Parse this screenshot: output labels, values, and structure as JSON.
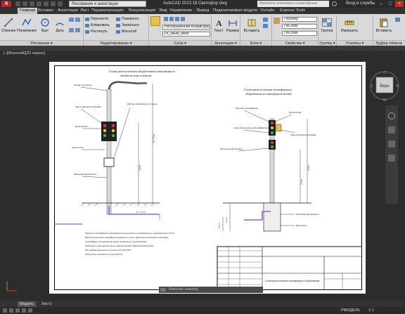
{
  "titlebar": {
    "logo": "A",
    "workspace": "Рисование и аннотации",
    "app_title": "AutoCAD 2013    18 Светофор.dwg",
    "search_placeholder": "Введите ключевое слово/фразу",
    "signin": "Вход в службы",
    "minimize": "–",
    "maximize": "□",
    "close": "×"
  },
  "tabs": [
    "Главная",
    "Вставка",
    "Аннотации",
    "Лист",
    "Параметризация",
    "Визуализация",
    "Вид",
    "Управление",
    "Вывод",
    "Подключаемые модули",
    "Онлайн",
    "Express Tools"
  ],
  "ribbon": {
    "draw": {
      "line": "Отрезок",
      "polyline": "Полилиния",
      "circle": "Круг",
      "arc": "Дуга",
      "panel": "Рисование ▾"
    },
    "modify": {
      "move": "Перенести",
      "rotate": "Повернуть",
      "copy": "Копировать",
      "mirror": "Зеркально",
      "stretch": "Растянуть",
      "scale": "Масштаб",
      "panel": "Редактирование ▾"
    },
    "layers": {
      "state": "Несохраненная конфигурация сло",
      "current": "LK_NEW_неок",
      "panel": "Слои ▾"
    },
    "annotation": {
      "text": "Текст",
      "dimension": "Размер",
      "panel": "Аннотации ▾"
    },
    "block": {
      "insert": "Вставить",
      "panel": "Блок ▾"
    },
    "properties": {
      "color": "ПоБлоку",
      "linetype": "ПоСлою",
      "lineweight": "ПоСлою",
      "panel": "Свойства ▾"
    },
    "groups": {
      "group": "Группа",
      "panel": "Группы ▾"
    },
    "utilities": {
      "measure": "Измерить",
      "panel": "Утилиты ▾"
    },
    "clipboard": {
      "paste": "Вставить",
      "panel": "Буфер обмена"
    }
  },
  "viewport": {
    "label": "[–][Верхний][2D каркас]"
  },
  "viewcube": {
    "top": "Верх",
    "n": "С",
    "s": "Ю",
    "w": "З",
    "e": "В"
  },
  "drawing": {
    "left_title": "Схема расположения оборудования светофорного",
    "left_subtitle": "объекта на опоре освещения",
    "right_title": "Схема расположения светофорного",
    "right_subtitle": "оборудования на светофорной колонке",
    "notes": [
      "Опора освещения",
      "Транспортный светофор",
      "Кронштейн",
      "Щиток для дорожного знака",
      "Колонка светофорная",
      "Крепление",
      "Бетонный фундамент",
      "Знак дополнительной информации"
    ],
    "dims": [
      "h=7,0 m",
      "5,4 m",
      "0,5 m",
      "45 - 5,0 m",
      "1,0 m",
      "1,5 m",
      "2,0 m",
      "0,5 m"
    ],
    "spec_text": [
      "Монтаж светофорного оборудования выполнить в соответствии с требованиями ГОСТ.",
      "Высоту установки светофоров принять по схеме. Крепления выполнить хомутами.",
      "Светофоры установить на опоре освещения на кронштейнах.",
      "Кабельные линии проложить в металлической гофрированной трубе.",
      "Все работы выполнить согласно СП 48.13330.",
      "Заземление выполнить согласно ПУЭ."
    ],
    "stamp_title": "Схема расположения светофорного оборудования"
  },
  "cmdline": {
    "placeholder": "Введите команду"
  },
  "layout_tabs": [
    "Модель",
    "Лист1"
  ],
  "status": {
    "model": "РМОДЕЛЬ",
    "scale": "1:1"
  }
}
